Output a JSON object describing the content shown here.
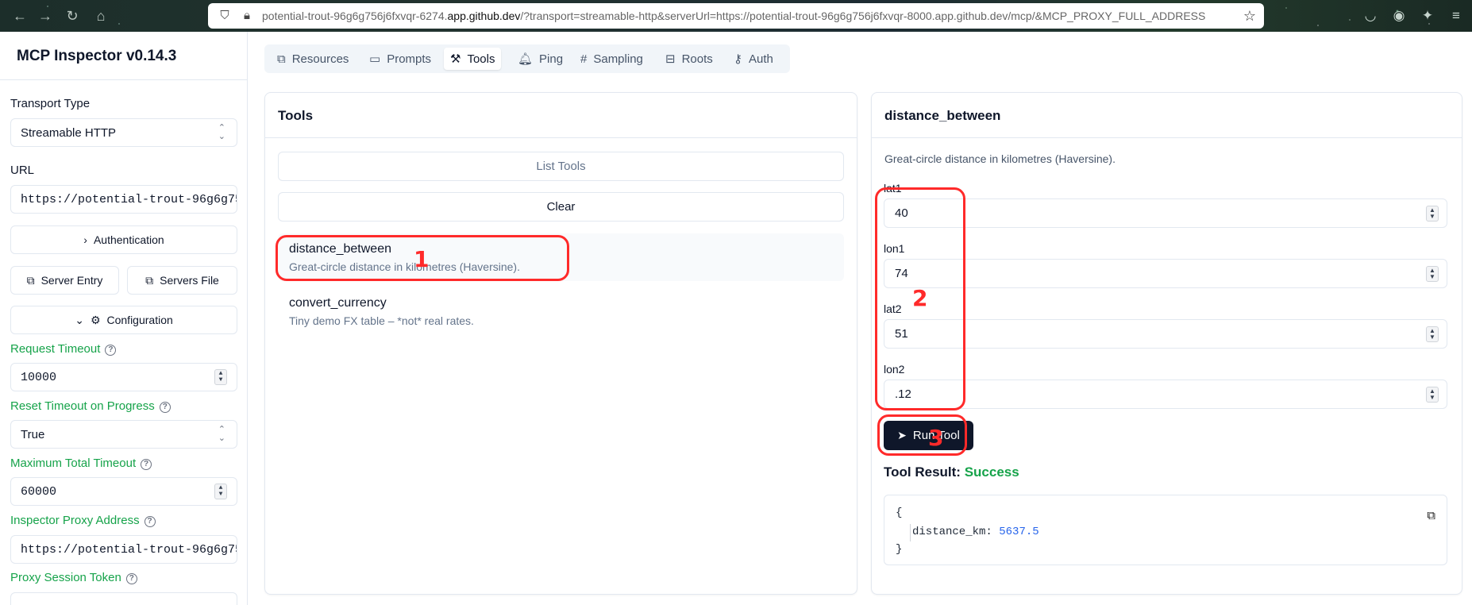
{
  "browser": {
    "url_prefix": "potential-trout-96g6g756j6fxvqr-6274.",
    "url_domain": "app.github.dev",
    "url_rest": "/?transport=streamable-http&serverUrl=https://potential-trout-96g6g756j6fxvqr-8000.app.github.dev/mcp/&MCP_PROXY_FULL_ADDRESS"
  },
  "sidebar": {
    "title": "MCP Inspector v0.14.3",
    "transport_label": "Transport Type",
    "transport_value": "Streamable HTTP",
    "url_label": "URL",
    "url_value": "https://potential-trout-96g6g75",
    "auth_button": "Authentication",
    "server_entry_button": "Server Entry",
    "servers_file_button": "Servers File",
    "config_button": "Configuration",
    "request_timeout_label": "Request Timeout",
    "request_timeout_value": "10000",
    "reset_timeout_label": "Reset Timeout on Progress",
    "reset_timeout_value": "True",
    "max_timeout_label": "Maximum Total Timeout",
    "max_timeout_value": "60000",
    "proxy_address_label": "Inspector Proxy Address",
    "proxy_address_value": "https://potential-trout-96g6g75",
    "proxy_token_label": "Proxy Session Token"
  },
  "tabs": [
    {
      "label": "Resources",
      "icon": "files-icon"
    },
    {
      "label": "Prompts",
      "icon": "message-icon"
    },
    {
      "label": "Tools",
      "icon": "hammer-icon",
      "active": true
    },
    {
      "label": "Ping",
      "icon": "bell-icon"
    },
    {
      "label": "Sampling",
      "icon": "hash-icon"
    },
    {
      "label": "Roots",
      "icon": "folder-tree-icon"
    },
    {
      "label": "Auth",
      "icon": "key-icon"
    }
  ],
  "tools_panel": {
    "title": "Tools",
    "list_button": "List Tools",
    "clear_button": "Clear",
    "tools": [
      {
        "name": "distance_between",
        "description": "Great-circle distance in kilometres (Haversine)."
      },
      {
        "name": "convert_currency",
        "description": "Tiny demo FX table – *not* real rates."
      }
    ]
  },
  "detail_panel": {
    "title": "distance_between",
    "description": "Great-circle distance in kilometres (Haversine).",
    "params": [
      {
        "label": "lat1",
        "value": "40"
      },
      {
        "label": "lon1",
        "value": "74"
      },
      {
        "label": "lat2",
        "value": "51"
      },
      {
        "label": "lon2",
        "value": ".12"
      }
    ],
    "run_button": "Run Tool",
    "result_label": "Tool Result:",
    "result_status": "Success",
    "result_open": "{",
    "result_key": "distance_km:",
    "result_value": "5637.5",
    "result_close": "}"
  },
  "annotations": [
    "1",
    "2",
    "3"
  ],
  "colors": {
    "accent_green": "#16a34a",
    "annotation_red": "#ff2a2a",
    "run_button_bg": "#0f172a",
    "json_value": "#2563eb"
  }
}
